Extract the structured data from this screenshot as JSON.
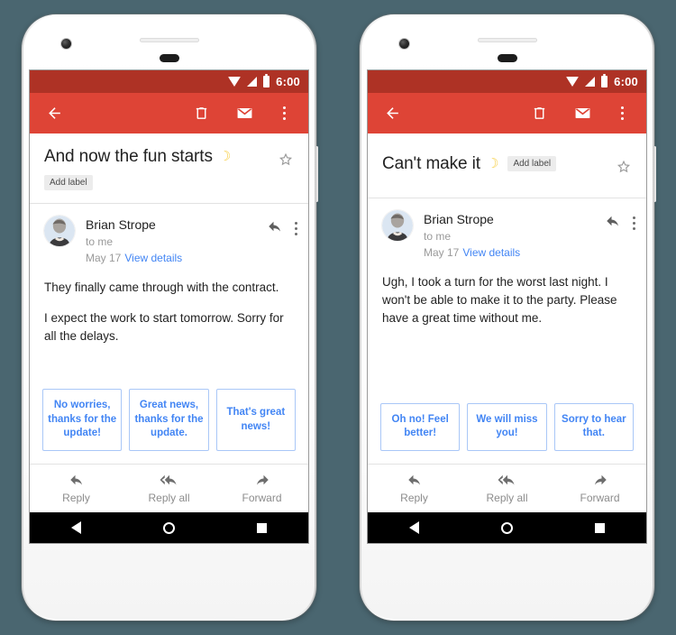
{
  "background_color": "#4a6670",
  "theme": {
    "status_bar_color": "#ae3225",
    "app_bar_color": "#de4436",
    "accent_blue": "#4285f4",
    "chip_border": "#a9c7f7",
    "label_chip_bg": "#ececec"
  },
  "phones": [
    {
      "id": "phone-left",
      "status_bar": {
        "time": "6:00",
        "icons": [
          "wifi-icon",
          "signal-icon",
          "battery-icon"
        ]
      },
      "app_bar": {
        "back_label": "back-arrow-icon",
        "actions": [
          "delete-icon",
          "mark-unread-icon",
          "overflow-menu-icon"
        ]
      },
      "subject": {
        "title": "And now the fun starts",
        "emoji": "☽",
        "label_chip": "Add label",
        "label_placement": "below",
        "starred": false,
        "star_icon": "star-outline-icon"
      },
      "message": {
        "sender": "Brian Strope",
        "recipient": "to me",
        "date": "May 17",
        "details_link": "View details",
        "actions": [
          "reply-icon",
          "overflow-menu-icon"
        ],
        "body": [
          "They finally came through with the contract.",
          "I expect the work to start tomorrow. Sorry for all the delays."
        ]
      },
      "smart_replies": [
        "No worries, thanks for the update!",
        "Great news, thanks for the update.",
        "That's great news!"
      ],
      "actions_bar": [
        {
          "label": "Reply",
          "icon": "reply-icon"
        },
        {
          "label": "Reply all",
          "icon": "reply-all-icon"
        },
        {
          "label": "Forward",
          "icon": "forward-icon"
        }
      ],
      "nav_bar": [
        "back-nav-icon",
        "home-nav-icon",
        "recents-nav-icon"
      ]
    },
    {
      "id": "phone-right",
      "status_bar": {
        "time": "6:00",
        "icons": [
          "wifi-icon",
          "signal-icon",
          "battery-icon"
        ]
      },
      "app_bar": {
        "back_label": "back-arrow-icon",
        "actions": [
          "delete-icon",
          "mark-unread-icon",
          "overflow-menu-icon"
        ]
      },
      "subject": {
        "title": "Can't make it",
        "emoji": "☽",
        "label_chip": "Add label",
        "label_placement": "inline",
        "starred": false,
        "star_icon": "star-outline-icon"
      },
      "message": {
        "sender": "Brian Strope",
        "recipient": "to me",
        "date": "May 17",
        "details_link": "View details",
        "actions": [
          "reply-icon",
          "overflow-menu-icon"
        ],
        "body": [
          "Ugh, I took a turn for the worst last night. I won't be able to make it to the party. Please have a great time without me."
        ]
      },
      "smart_replies": [
        "Oh no! Feel better!",
        "We will miss you!",
        "Sorry to hear that."
      ],
      "actions_bar": [
        {
          "label": "Reply",
          "icon": "reply-icon"
        },
        {
          "label": "Reply all",
          "icon": "reply-all-icon"
        },
        {
          "label": "Forward",
          "icon": "forward-icon"
        }
      ],
      "nav_bar": [
        "back-nav-icon",
        "home-nav-icon",
        "recents-nav-icon"
      ]
    }
  ]
}
